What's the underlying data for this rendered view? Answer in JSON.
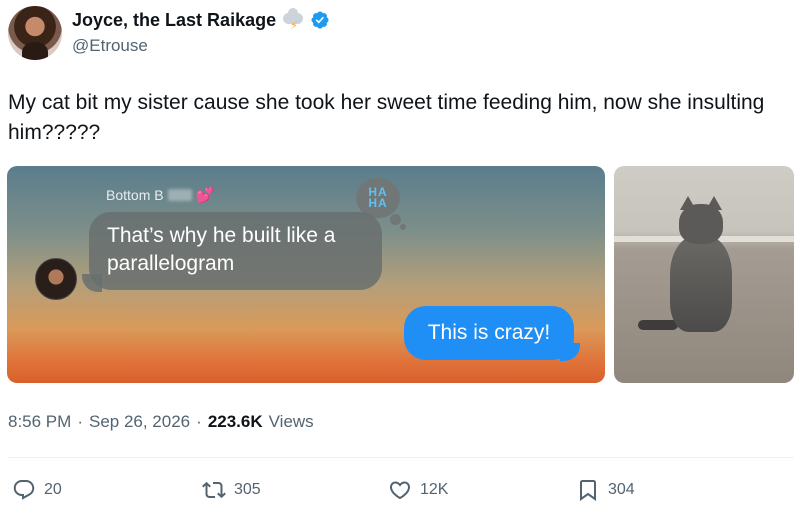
{
  "author": {
    "display_name": "Joyce, the Last Raikage",
    "handle": "@Etrouse",
    "emoji_icon": "cloud-lightning-icon",
    "verified_icon": "verified-badge-icon"
  },
  "tweet": {
    "text": "My cat bit my sister cause she took her sweet time feeding him, now she insulting him?????"
  },
  "media": {
    "chat": {
      "sender_name": "Bottom B",
      "sender_emoji": "💕",
      "received_message": "That’s why he built like a parallelogram",
      "reaction_line1": "HA",
      "reaction_line2": "HA",
      "sent_message": "This is crazy!"
    }
  },
  "meta": {
    "time": "8:56 PM",
    "date": "Sep 26, 2026",
    "views_count": "223.6K",
    "views_label": "Views"
  },
  "actions": {
    "reply_count": "20",
    "retweet_count": "305",
    "like_count": "12K",
    "bookmark_count": "304"
  },
  "colors": {
    "verified": "#1d9bf0",
    "imessage_blue": "#1f8ef5",
    "muted_text": "#536471"
  }
}
